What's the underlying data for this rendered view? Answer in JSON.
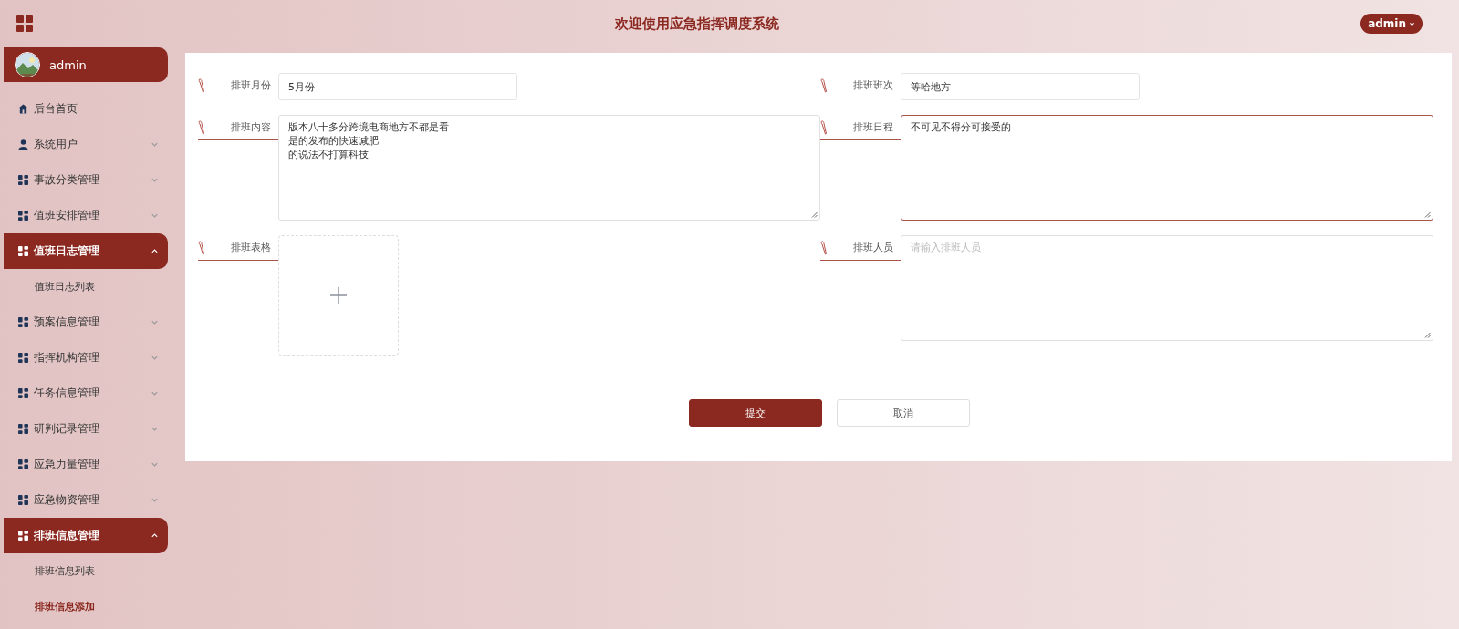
{
  "header": {
    "title": "欢迎使用应急指挥调度系统",
    "user_button": "admin"
  },
  "sidebar": {
    "profile": {
      "name": "admin"
    },
    "items": [
      {
        "kind": "link",
        "label": "后台首页"
      },
      {
        "kind": "group",
        "label": "系统用户",
        "expanded": false
      },
      {
        "kind": "group",
        "label": "事故分类管理",
        "expanded": false
      },
      {
        "kind": "group",
        "label": "值班安排管理",
        "expanded": false
      },
      {
        "kind": "group",
        "label": "值班日志管理",
        "expanded": true,
        "children": [
          {
            "label": "值班日志列表",
            "selected": false
          }
        ]
      },
      {
        "kind": "group",
        "label": "预案信息管理",
        "expanded": false
      },
      {
        "kind": "group",
        "label": "指挥机构管理",
        "expanded": false
      },
      {
        "kind": "group",
        "label": "任务信息管理",
        "expanded": false
      },
      {
        "kind": "group",
        "label": "研判记录管理",
        "expanded": false
      },
      {
        "kind": "group",
        "label": "应急力量管理",
        "expanded": false
      },
      {
        "kind": "group",
        "label": "应急物资管理",
        "expanded": false
      },
      {
        "kind": "group",
        "label": "排班信息管理",
        "expanded": true,
        "children": [
          {
            "label": "排班信息列表",
            "selected": false
          },
          {
            "label": "排班信息添加",
            "selected": true
          }
        ]
      }
    ]
  },
  "form": {
    "fields": [
      {
        "kind": "input",
        "label": "排班月份",
        "value": "5月份",
        "focused": false
      },
      {
        "kind": "input",
        "label": "排班班次",
        "value": "等哈地方",
        "focused": false
      },
      {
        "kind": "textarea",
        "label": "排班内容",
        "lines": [
          "版本八十多分跨境电商地方不都是看",
          "是的发布的快速减肥",
          "的说法不打算科技"
        ],
        "focused": false
      },
      {
        "kind": "textarea",
        "label": "排班日程",
        "lines": [
          "不可见不得分可接受的"
        ],
        "focused": true
      },
      {
        "kind": "upload",
        "label": "排班表格"
      },
      {
        "kind": "textarea",
        "label": "排班人员",
        "placeholder": "请输入排班人员",
        "focused": false
      }
    ],
    "buttons": [
      {
        "kind": "primary",
        "label": "提交"
      },
      {
        "kind": "default",
        "label": "取消"
      }
    ]
  }
}
